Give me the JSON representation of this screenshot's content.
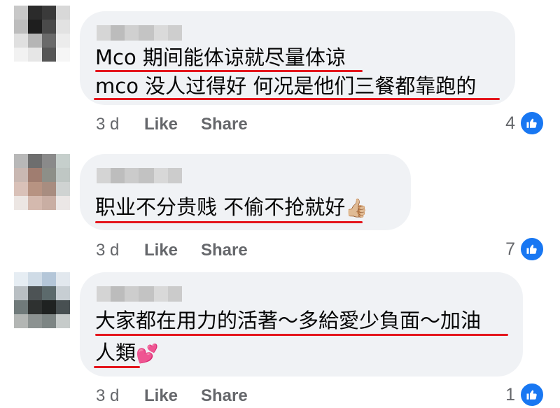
{
  "colors": {
    "bubble_bg": "#f0f2f5",
    "underline": "#e4161d",
    "meta_text": "#65676b",
    "like_blue": "#1877f2"
  },
  "comments": [
    {
      "lines": [
        "Mco 期间能体谅就尽量体谅",
        "mco 没人过得好 何况是他们三餐都靠跑的"
      ],
      "emoji": "",
      "time": "3 d",
      "like_label": "Like",
      "share_label": "Share",
      "reaction_count": "4",
      "reaction_icon": "thumbs-up-icon"
    },
    {
      "lines": [
        "职业不分贵贱 不偷不抢就好"
      ],
      "emoji": "👍🏼",
      "emoji_icon": "thumbs-up-emoji-icon",
      "time": "3 d",
      "like_label": "Like",
      "share_label": "Share",
      "reaction_count": "7",
      "reaction_icon": "thumbs-up-icon"
    },
    {
      "lines": [
        "大家都在用力的活著～多給愛少負面～加油",
        "人類"
      ],
      "emoji": "💕",
      "emoji_icon": "two-hearts-emoji-icon",
      "time": "3 d",
      "like_label": "Like",
      "share_label": "Share",
      "reaction_count": "1",
      "reaction_icon": "thumbs-up-icon"
    }
  ]
}
